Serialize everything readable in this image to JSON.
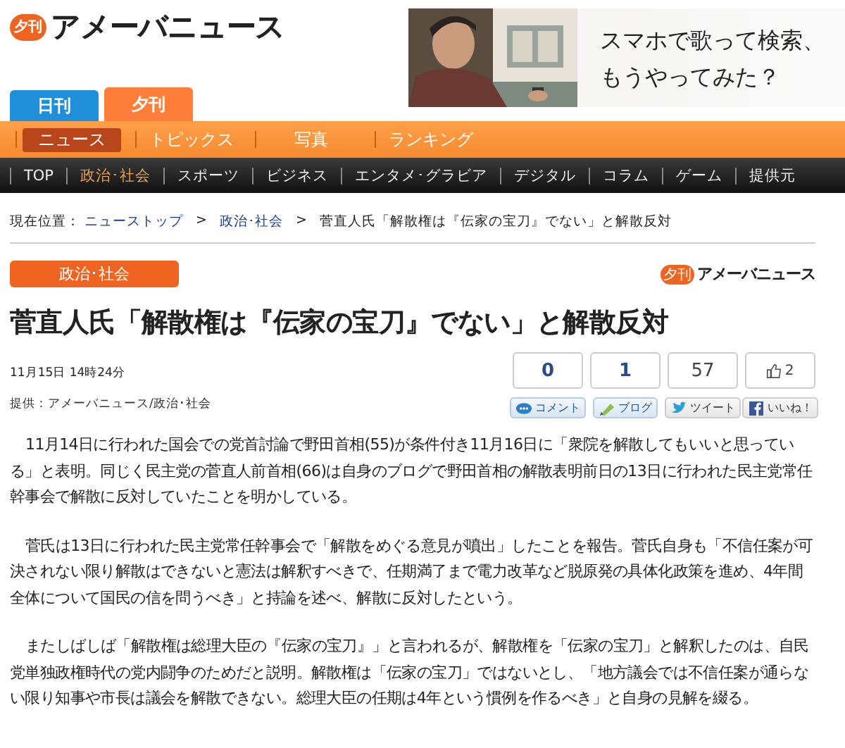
{
  "header": {
    "logo_badge": "夕刊",
    "logo_text": "アメーバニュース",
    "ad": {
      "kind": "picture",
      "lines": [
        "スマホで歌って検索、",
        "もうやってみた？"
      ]
    }
  },
  "edition_tabs": [
    {
      "label": "日刊",
      "selected": false
    },
    {
      "label": "夕刊",
      "selected": true
    }
  ],
  "section_nav": [
    {
      "label": "ニュース",
      "selected": true
    },
    {
      "label": "トピックス",
      "selected": false
    },
    {
      "label": "写真",
      "selected": false
    },
    {
      "label": "ランキング",
      "selected": false
    }
  ],
  "category_nav": [
    {
      "label": "TOP",
      "selected": false
    },
    {
      "label": "政治･社会",
      "selected": true
    },
    {
      "label": "スポーツ",
      "selected": false
    },
    {
      "label": "ビジネス",
      "selected": false
    },
    {
      "label": "エンタメ･グラビア",
      "selected": false
    },
    {
      "label": "デジタル",
      "selected": false
    },
    {
      "label": "コラム",
      "selected": false
    },
    {
      "label": "ゲーム",
      "selected": false
    },
    {
      "label": "提供元",
      "selected": false
    }
  ],
  "breadcrumb": {
    "prefix": "現在位置：",
    "links": [
      "ニューストップ",
      "政治･社会"
    ],
    "separator": ">",
    "current": "菅直人氏「解散権は『伝家の宝刀』でない」と解散反対"
  },
  "article": {
    "category": "政治･社会",
    "source_logo": {
      "badge": "夕刊",
      "text": "アメーバニュース"
    },
    "title": "菅直人氏「解散権は『伝家の宝刀』でない」と解散反対",
    "date": "11月15日 14時24分",
    "source": "提供：アメーバニュース/政治･社会",
    "social": [
      {
        "kind": "comment",
        "count": "0",
        "label": "コメント"
      },
      {
        "kind": "blog",
        "count": "1",
        "label": "ブログ"
      },
      {
        "kind": "tweet",
        "count": "57",
        "label": "ツイート"
      },
      {
        "kind": "like",
        "count": "2",
        "label": "いいね！"
      }
    ],
    "paragraphs": [
      "11月14日に行われた国会での党首討論で野田首相(55)が条件付き11月16日に「衆院を解散してもいいと思っている」と表明。同じく民主党の菅直人前首相(66)は自身のブログで野田首相の解散表明前日の13日に行われた民主党常任幹事会で解散に反対していたことを明かしている。",
      "菅氏は13日に行われた民主党常任幹事会で「解散をめぐる意見が噴出」したことを報告。菅氏自身も「不信任案が可決されない限り解散はできないと憲法は解釈すべきで、任期満了まで電力改革など脱原発の具体化政策を進め、4年間全体について国民の信を問うべき」と持論を述べ、解散に反対したという。",
      "またしばしば「解散権は総理大臣の『伝家の宝刀』」と言われるが、解散権を「伝家の宝刀」と解釈したのは、自民党単独政権時代の党内闘争のためだと説明。解散権は「伝家の宝刀」ではないとし、「地方議会では不信任案が通らない限り知事や市長は議会を解散できない。総理大臣の任期は4年という慣例を作るべき」と自身の見解を綴る。"
    ]
  }
}
